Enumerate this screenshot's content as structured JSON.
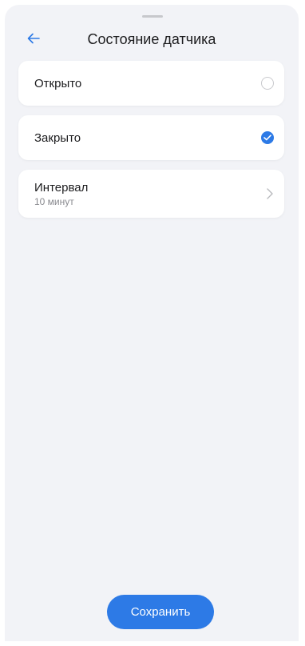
{
  "header": {
    "title": "Состояние датчика",
    "back_icon": "arrow-left-icon"
  },
  "options": [
    {
      "label": "Открыто",
      "selected": false
    },
    {
      "label": "Закрыто",
      "selected": true
    }
  ],
  "interval": {
    "label": "Интервал",
    "value": "10 минут"
  },
  "footer": {
    "save_label": "Сохранить"
  },
  "colors": {
    "accent": "#2d7ae6",
    "background": "#f2f3f7",
    "card": "#ffffff",
    "secondary_text": "#8a8b90"
  }
}
